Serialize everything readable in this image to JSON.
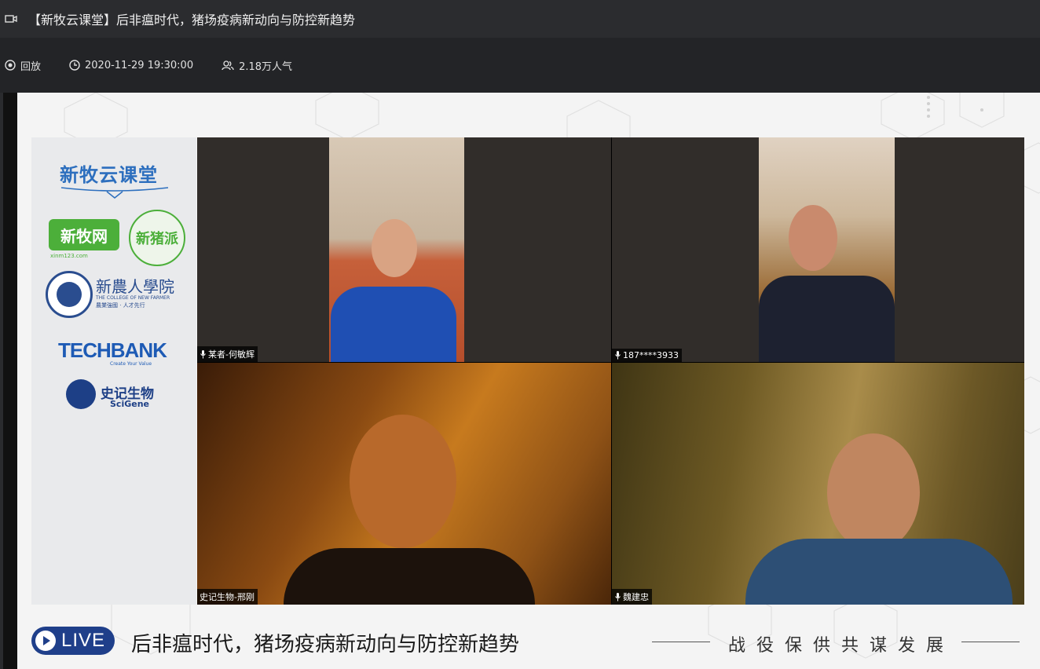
{
  "window": {
    "title": "【新牧云课堂】后非瘟时代，猪场疫病新动向与防控新趋势",
    "icon": "video-camera-icon"
  },
  "info": {
    "replay_label": "回放",
    "datetime": "2020-11-29 19:30:00",
    "popularity": "2.18万人气"
  },
  "sponsors": {
    "brand1": "新牧云课堂",
    "brand2": "新牧网",
    "brand2_url": "xinm123.com",
    "brand3": "新猪派",
    "brand4": "新農人學院",
    "brand4_en": "THE COLLEGE OF NEW FARMER",
    "brand4_motto": "農業強國 · 人才先行",
    "brand5": "TECHBANK",
    "brand5_sub": "Create Your Value",
    "brand6": "史记生物",
    "brand6_en": "SciGene"
  },
  "participants": [
    {
      "name": "某者-何敏辉",
      "mic": "microphone-icon"
    },
    {
      "name": "187****3933",
      "mic": "microphone-icon"
    },
    {
      "name": "史记生物-邢刚",
      "mic": ""
    },
    {
      "name": "魏建忠",
      "mic": "microphone-icon"
    }
  ],
  "banner": {
    "live_label": "LIVE",
    "title": "后非瘟时代，猪场疫病新动向与防控新趋势",
    "slogan": "战役保供共谋发展"
  },
  "colors": {
    "brand_blue": "#2d6fbe",
    "brand_green": "#4caf3a",
    "live_blue": "#1f3f8a"
  }
}
